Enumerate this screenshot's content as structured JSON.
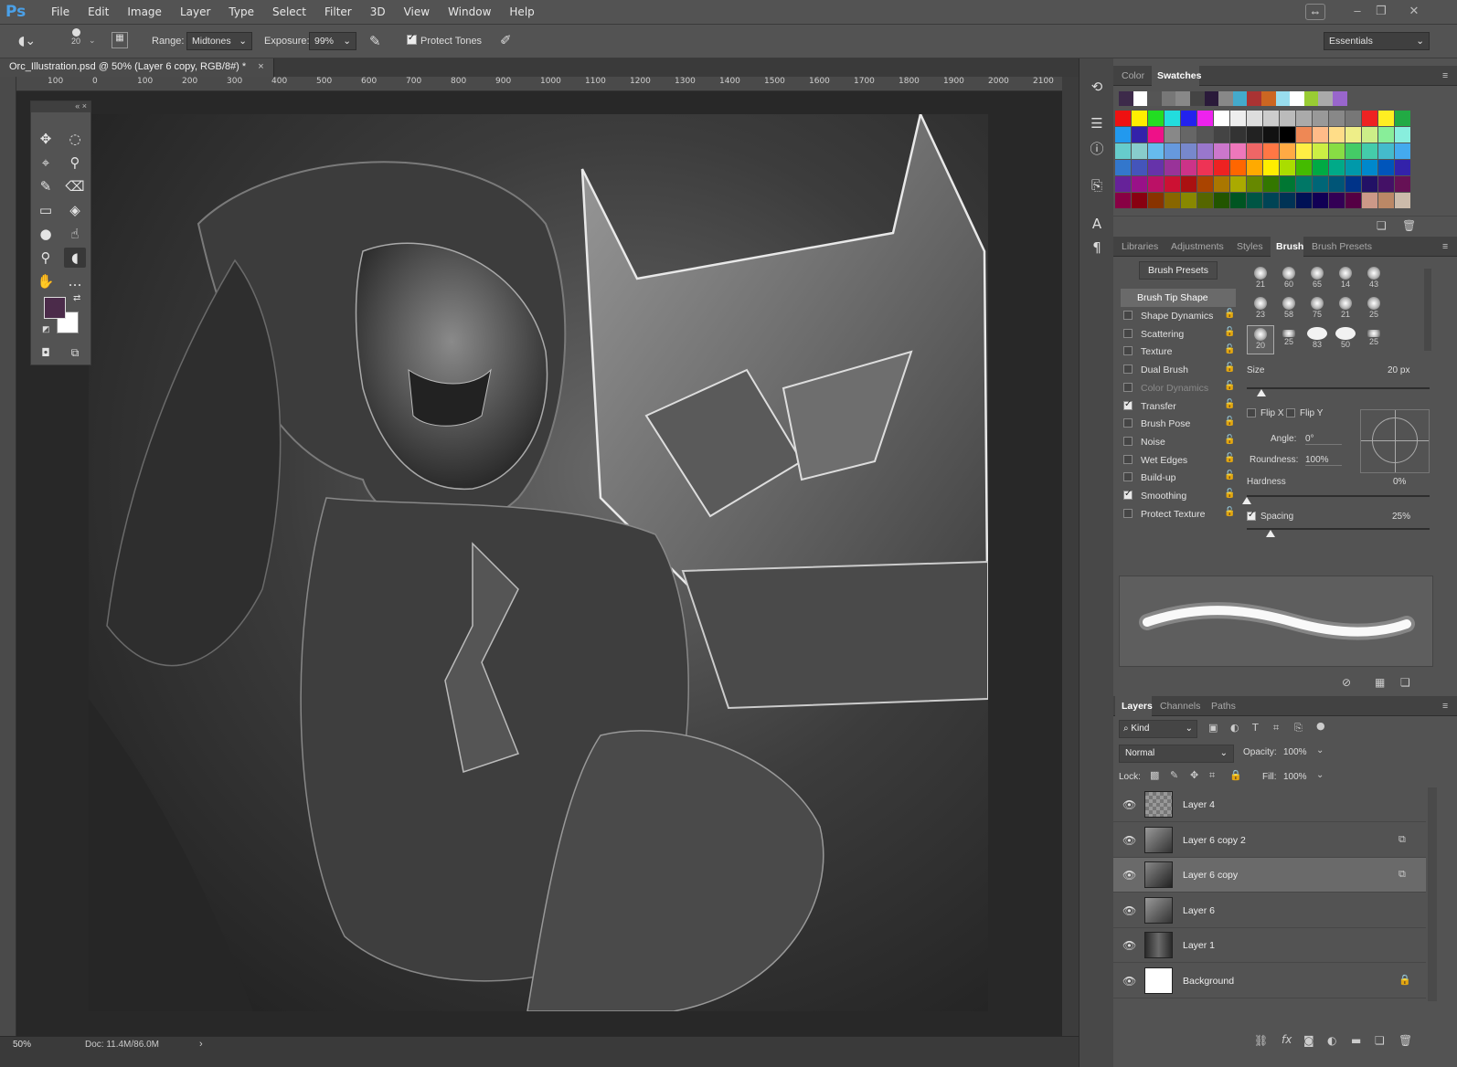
{
  "app": {
    "logo": "Ps"
  },
  "menu": [
    "File",
    "Edit",
    "Image",
    "Layer",
    "Type",
    "Select",
    "Filter",
    "3D",
    "View",
    "Window",
    "Help"
  ],
  "options": {
    "brush_size": "20",
    "range_label": "Range:",
    "range_value": "Midtones",
    "exposure_label": "Exposure:",
    "exposure_value": "99%",
    "protect_tones": "Protect Tones",
    "workspace": "Essentials"
  },
  "document": {
    "tab_title": "Orc_Illustration.psd @ 50% (Layer 6 copy, RGB/8#) *"
  },
  "ruler": {
    "h_ticks": [
      "100",
      "0",
      "100",
      "200",
      "300",
      "400",
      "500",
      "600",
      "700",
      "800",
      "900",
      "1000",
      "1100",
      "1200",
      "1300",
      "1400",
      "1500",
      "1600",
      "1700",
      "1800",
      "1900",
      "2000",
      "2100"
    ]
  },
  "status": {
    "zoom": "50%",
    "doc": "Doc: 11.4M/86.0M"
  },
  "swatch_panel": {
    "tabs": [
      "Color",
      "Swatches"
    ],
    "active": "Swatches"
  },
  "brush_panel": {
    "tabs": [
      "Libraries",
      "Adjustments",
      "Styles",
      "Brush",
      "Brush Presets"
    ],
    "active": "Brush",
    "presets_button": "Brush Presets",
    "tip_shape": "Brush Tip Shape",
    "options": [
      {
        "label": "Shape Dynamics",
        "checked": false
      },
      {
        "label": "Scattering",
        "checked": false
      },
      {
        "label": "Texture",
        "checked": false
      },
      {
        "label": "Dual Brush",
        "checked": false
      },
      {
        "label": "Color Dynamics",
        "checked": false
      },
      {
        "label": "Transfer",
        "checked": true
      },
      {
        "label": "Brush Pose",
        "checked": false
      },
      {
        "label": "Noise",
        "checked": false
      },
      {
        "label": "Wet Edges",
        "checked": false
      },
      {
        "label": "Build-up",
        "checked": false
      },
      {
        "label": "Smoothing",
        "checked": true
      },
      {
        "label": "Protect Texture",
        "checked": false
      }
    ],
    "tip_sizes": [
      "21",
      "60",
      "65",
      "14",
      "43",
      "23",
      "58",
      "75",
      "21",
      "25",
      "20",
      "25",
      "83",
      "50",
      "25"
    ],
    "size_label": "Size",
    "size_value": "20 px",
    "flip_x": "Flip X",
    "flip_y": "Flip Y",
    "angle_label": "Angle:",
    "angle_value": "0°",
    "roundness_label": "Roundness:",
    "roundness_value": "100%",
    "hardness_label": "Hardness",
    "hardness_value": "0%",
    "spacing_label": "Spacing",
    "spacing_value": "25%",
    "size_level": 0.08,
    "hardness_level": 0.0,
    "spacing_level": 0.13
  },
  "layers_panel": {
    "tabs": [
      "Layers",
      "Channels",
      "Paths"
    ],
    "active": "Layers",
    "kind": "Kind",
    "blend_mode": "Normal",
    "opacity_label": "Opacity:",
    "opacity_value": "100%",
    "lock_label": "Lock:",
    "fill_label": "Fill:",
    "fill_value": "100%",
    "layers": [
      {
        "name": "Layer 4",
        "selected": false,
        "badge": ""
      },
      {
        "name": "Layer 6 copy 2",
        "selected": false,
        "badge": "link"
      },
      {
        "name": "Layer 6 copy",
        "selected": true,
        "badge": "link"
      },
      {
        "name": "Layer 6",
        "selected": false,
        "badge": ""
      },
      {
        "name": "Layer 1",
        "selected": false,
        "badge": ""
      },
      {
        "name": "Background",
        "selected": false,
        "badge": "lock"
      }
    ]
  },
  "colors": {
    "foreground": "#4b2b4a",
    "background": "#ffffff",
    "accent": "#4aa0e8"
  }
}
